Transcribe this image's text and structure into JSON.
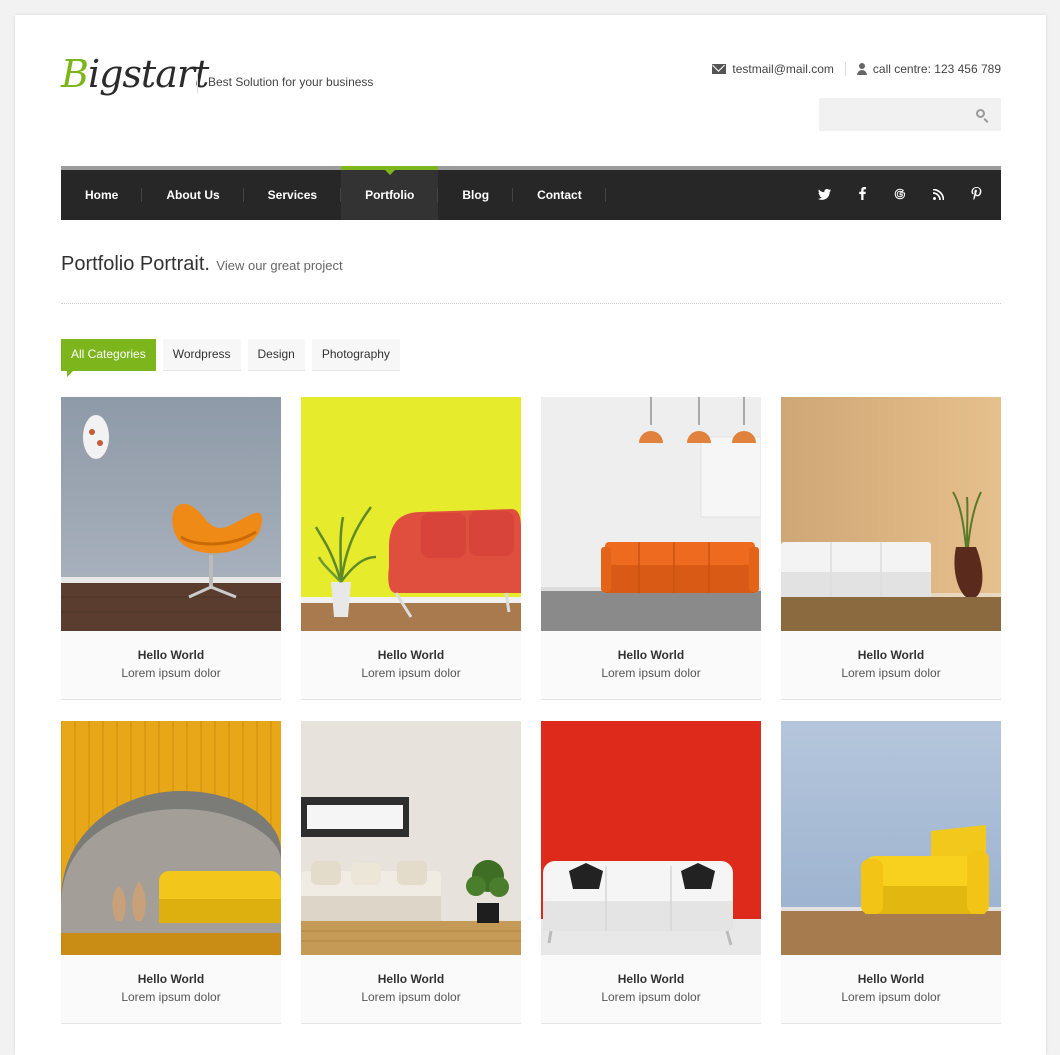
{
  "header": {
    "logo_first": "B",
    "logo_rest": "igstart",
    "tagline": "Best Solution for your business",
    "email": "testmail@mail.com",
    "phone": "call centre: 123 456 789",
    "search_placeholder": ""
  },
  "nav": {
    "items": [
      "Home",
      "About Us",
      "Services",
      "Portfolio",
      "Blog",
      "Contact"
    ],
    "active": "Portfolio",
    "social": [
      "twitter-icon",
      "facebook-icon",
      "google-icon",
      "rss-icon",
      "pinterest-icon"
    ]
  },
  "page": {
    "title": "Portfolio Portrait.",
    "subtitle": "View our great project"
  },
  "filters": [
    "All Categories",
    "Wordpress",
    "Design",
    "Photography"
  ],
  "portfolio": [
    {
      "title": "Hello World",
      "desc": "Lorem ipsum dolor"
    },
    {
      "title": "Hello World",
      "desc": "Lorem ipsum dolor"
    },
    {
      "title": "Hello World",
      "desc": "Lorem ipsum dolor"
    },
    {
      "title": "Hello World",
      "desc": "Lorem ipsum dolor"
    },
    {
      "title": "Hello World",
      "desc": "Lorem ipsum dolor"
    },
    {
      "title": "Hello World",
      "desc": "Lorem ipsum dolor"
    },
    {
      "title": "Hello World",
      "desc": "Lorem ipsum dolor"
    },
    {
      "title": "Hello World",
      "desc": "Lorem ipsum dolor"
    }
  ],
  "colors": {
    "accent": "#7cb51c",
    "nav_bg": "#272727"
  }
}
